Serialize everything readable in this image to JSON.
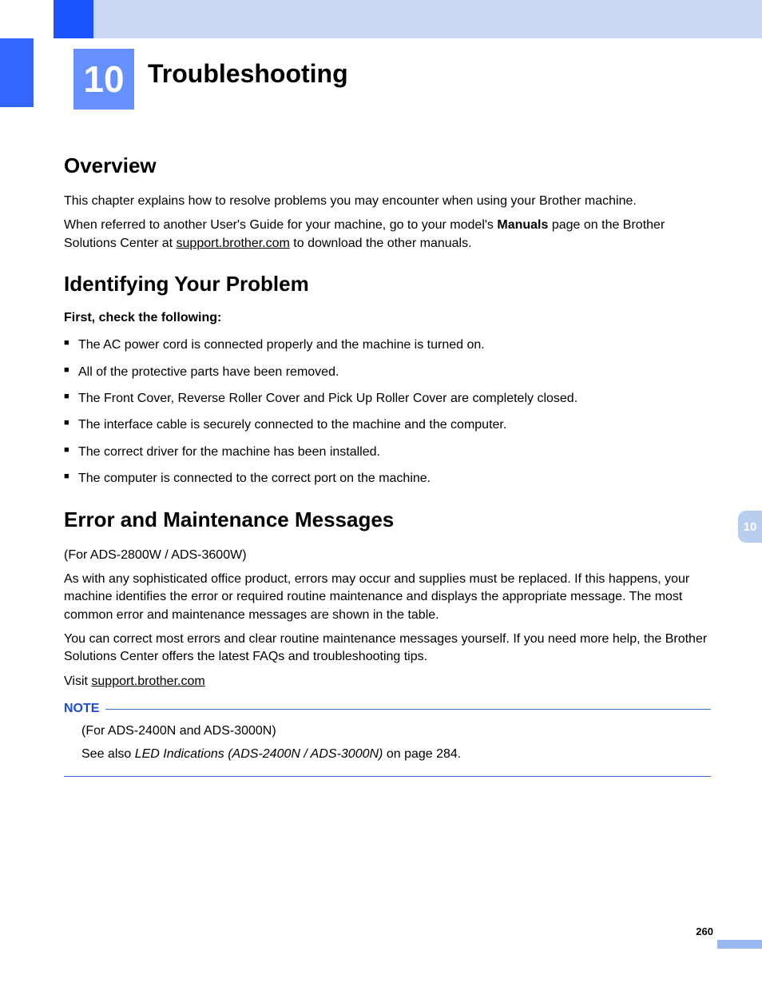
{
  "chapter": {
    "number": "10",
    "title": "Troubleshooting"
  },
  "sideTab": "10",
  "pageNumber": "260",
  "overview": {
    "heading": "Overview",
    "p1": "This chapter explains how to resolve problems you may encounter when using your Brother machine.",
    "p2_before": "When referred to another User's Guide for your machine, go to your model's ",
    "p2_bold": "Manuals",
    "p2_mid": " page on the Brother Solutions Center at ",
    "p2_link": "support.brother.com",
    "p2_after": " to download the other manuals."
  },
  "identifying": {
    "heading": "Identifying Your Problem",
    "checkHeading": "First, check the following:",
    "bullets": [
      "The AC power cord is connected properly and the machine is turned on.",
      "All of the protective parts have been removed.",
      "The Front Cover, Reverse Roller Cover and Pick Up Roller Cover are completely closed.",
      "The interface cable is securely connected to the machine and the computer.",
      "The correct driver for the machine has been installed.",
      "The computer is connected to the correct port on the machine."
    ]
  },
  "errorSection": {
    "heading": "Error and Maintenance Messages",
    "models": "(For ADS-2800W / ADS-3600W)",
    "p1": "As with any sophisticated office product, errors may occur and supplies must be replaced. If this happens, your machine identifies the error or required routine maintenance and displays the appropriate message. The most common error and maintenance messages are shown in the table.",
    "p2": "You can correct most errors and clear routine maintenance messages yourself. If you need more help, the Brother Solutions Center offers the latest FAQs and troubleshooting tips.",
    "p3_before": "Visit ",
    "p3_link": "support.brother.com",
    "note": {
      "label": "NOTE",
      "models": "(For ADS-2400N and ADS-3000N)",
      "text_before": "See also ",
      "text_italic": "LED Indications (ADS-2400N / ADS-3000N)",
      "text_after": " on page 284."
    }
  }
}
